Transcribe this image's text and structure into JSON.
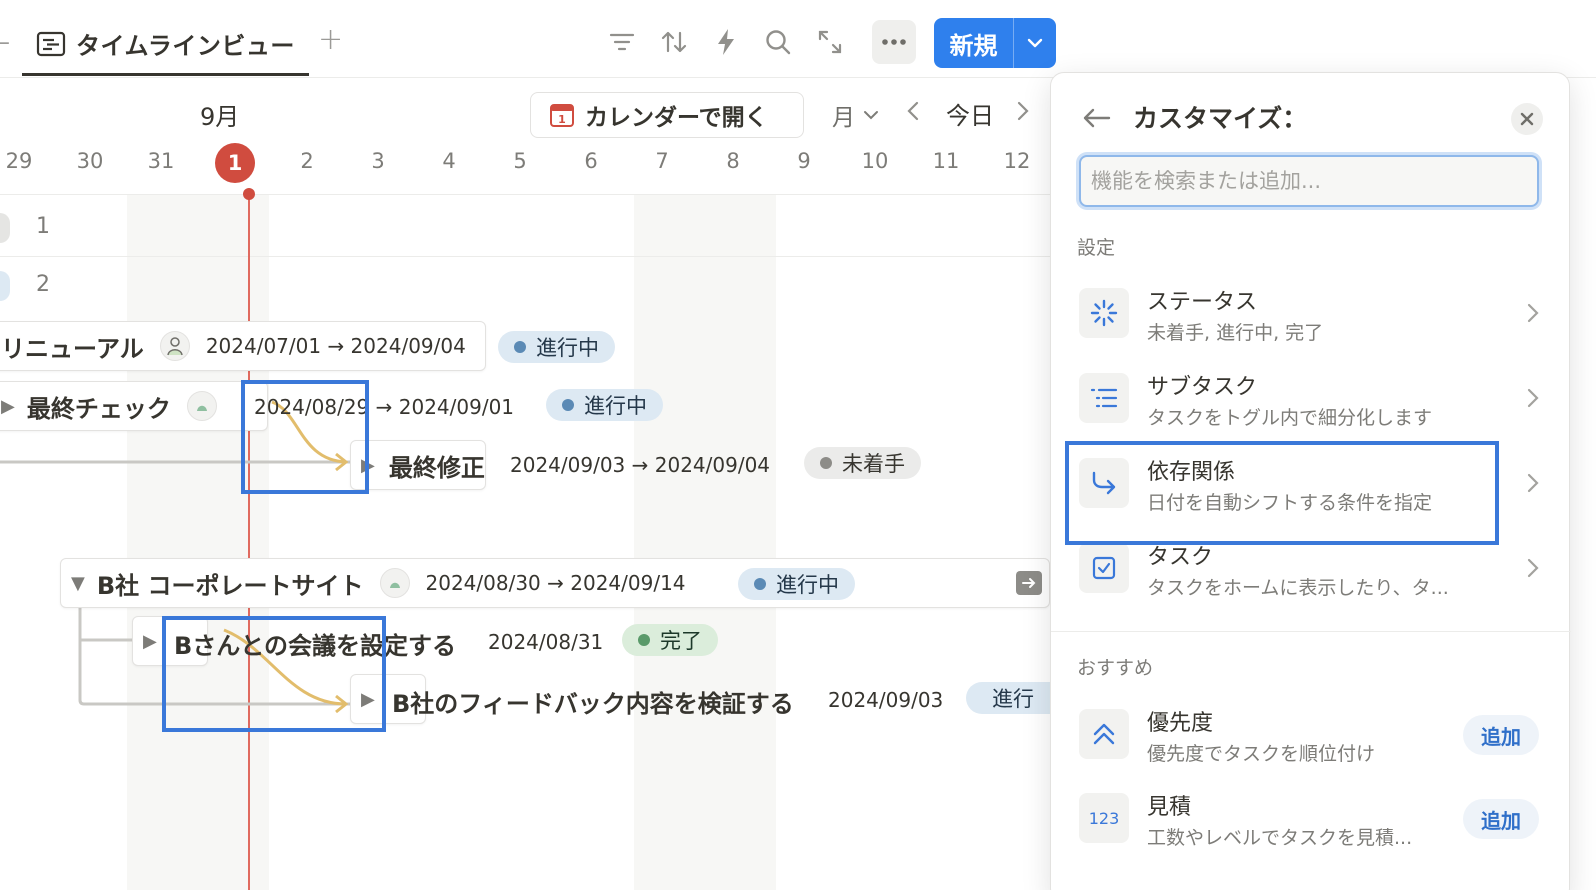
{
  "header": {
    "tab_title": "タイムラインビュー",
    "new_label": "新規"
  },
  "timeline": {
    "month": "9月",
    "open_calendar": "カレンダーで開く",
    "calendar_icon_num": "1",
    "period": "月",
    "today": "今日",
    "days": [
      "29",
      "30",
      "31",
      "1",
      "2",
      "3",
      "4",
      "5",
      "6",
      "7",
      "8",
      "9",
      "10",
      "11",
      "12"
    ],
    "groups": [
      "1",
      "2"
    ],
    "tasks": [
      {
        "title": "リニューアル",
        "dates": "2024/07/01 → 2024/09/04",
        "status": "進行中"
      },
      {
        "title": "最終チェック",
        "dates": "2024/08/29 → 2024/09/01",
        "status": "進行中"
      },
      {
        "title": "最終修正",
        "dates": "2024/09/03 → 2024/09/04",
        "status": "未着手"
      },
      {
        "title": "B社 コーポレートサイト",
        "dates": "2024/08/30 → 2024/09/14",
        "status": "進行中"
      },
      {
        "title": "Bさんとの会議を設定する",
        "dates": "2024/08/31",
        "status": "完了"
      },
      {
        "title": "B社のフィードバック内容を検証する",
        "dates": "2024/09/03",
        "status": "進行"
      }
    ]
  },
  "panel": {
    "title": "カスタマイズ：",
    "search_placeholder": "機能を検索または追加...",
    "settings_label": "設定",
    "settings": [
      {
        "name": "ステータス",
        "desc": "未着手, 進行中, 完了",
        "icon": "status-icon"
      },
      {
        "name": "サブタスク",
        "desc": "タスクをトグル内で細分化します",
        "icon": "subtask-icon"
      },
      {
        "name": "依存関係",
        "desc": "日付を自動シフトする条件を指定",
        "icon": "dependency-icon"
      },
      {
        "name": "タスク",
        "desc": "タスクをホームに表示したり、タ...",
        "icon": "checkbox-icon"
      }
    ],
    "recommended_label": "おすすめ",
    "recommended": [
      {
        "name": "優先度",
        "desc": "優先度でタスクを順位付け",
        "icon": "priority-icon",
        "action": "追加"
      },
      {
        "name": "見積",
        "desc": "工数やレベルでタスクを見積...",
        "icon": "estimate-icon",
        "icon_text": "123",
        "action": "追加"
      }
    ]
  },
  "colors": {
    "accent": "#2f80ed",
    "today": "#d04c3f",
    "highlight": "#3a78d9",
    "dependency_arrow": "#e2bd6c"
  }
}
